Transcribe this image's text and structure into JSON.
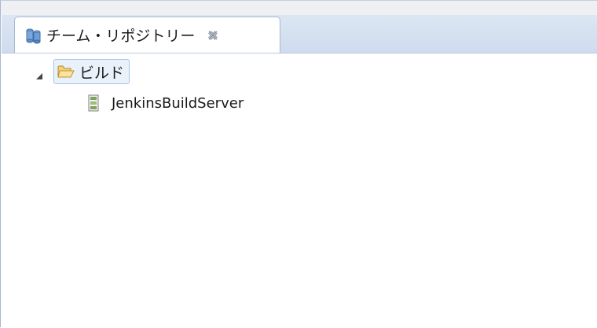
{
  "view": {
    "tab_title": "チーム・リポジトリー",
    "tab_icon": "team-repository-icon",
    "close_icon": "close-icon"
  },
  "tree": {
    "items": [
      {
        "label": "ビルド",
        "icon": "folder-open-icon",
        "expanded": true,
        "selected": true,
        "children": [
          {
            "label": "JenkinsBuildServer",
            "icon": "build-server-icon"
          }
        ]
      }
    ]
  },
  "colors": {
    "tab_bar": "#d5e1f0",
    "selection_bg": "#e9f1fb",
    "selection_border": "#a8c4e8",
    "folder_icon": "#e8b84a",
    "server_icon": "#7fa35b"
  }
}
